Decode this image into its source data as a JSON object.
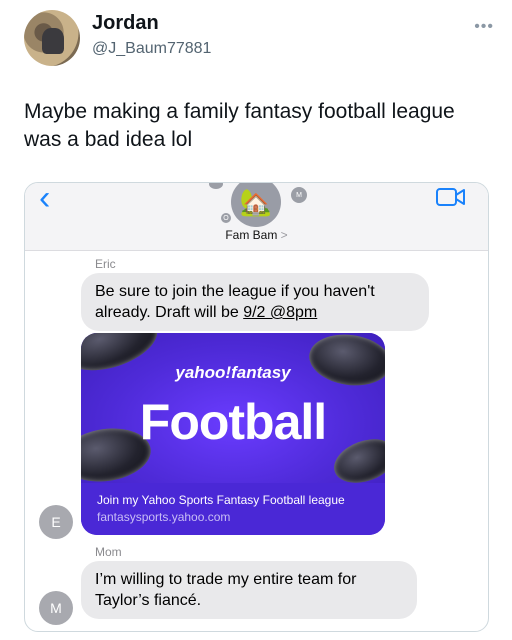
{
  "tweet": {
    "author_name": "Jordan",
    "author_handle": "@J_Baum77881",
    "text": "Maybe making a family fantasy football league was a bad idea lol"
  },
  "conversation": {
    "group_name": "Fam Bam",
    "group_chevron": ">",
    "group_emoji": "🏡",
    "header_initials": {
      "small_m": "M",
      "small_o": "O"
    },
    "messages": [
      {
        "sender": "Eric",
        "text_before": "Be sure to join the league if you haven't already. Draft will be ",
        "link_text": "9/2 @8pm",
        "avatar_initial": "E"
      },
      {
        "sender": "Mom",
        "text": "I’m willing to trade my entire team for Taylor’s fiancé.",
        "avatar_initial": "M"
      }
    ],
    "link_preview": {
      "brand": "yahoo!fantasy",
      "headline": "Football",
      "title": "Join my Yahoo Sports Fantasy Football league",
      "url": "fantasysports.yahoo.com"
    }
  },
  "colors": {
    "ios_blue": "#1a82fb",
    "yahoo_purple": "#4a28d6",
    "bubble_gray": "#e9e9eb"
  },
  "icons": [
    "more-icon",
    "back-chevron-icon",
    "video-call-icon"
  ]
}
